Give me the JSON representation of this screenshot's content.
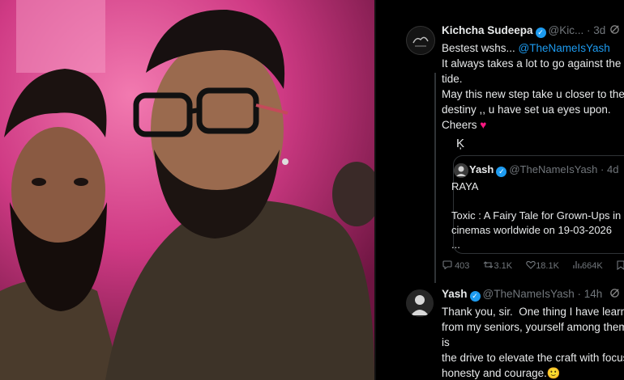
{
  "tweet1": {
    "name": "Kichcha Sudeepa",
    "handle": "@Kic...",
    "time": "· 3d",
    "body_prefix": "Bestest wshs... ",
    "mention": "@TheNameIsYash",
    "body_rest": "It always takes a lot to go against the\ntide.\nMay this new step take u closer to the\ndestiny ,, u have set ua eyes upon.\nCheers ",
    "heart": "♥",
    "signature": "Ķ"
  },
  "quote": {
    "name": "Yash",
    "handle": "@TheNameIsYash",
    "time": "· 4d",
    "body": "RAYA\n\nToxic : A Fairy Tale for Grown-Ups in\ncinemas worldwide on 19-03-2026\n..."
  },
  "actions": {
    "replies": "403",
    "reposts": "3.1K",
    "likes": "18.1K",
    "views": "664K"
  },
  "tweet2": {
    "name": "Yash",
    "handle": "@TheNameIsYash",
    "time": "· 14h",
    "body": "Thank you, sir.  One thing I have learnt\nfrom my seniors, yourself among them, is\nthe drive to elevate the craft with focus,\nhonesty and courage.",
    "emoji": "🙂"
  },
  "icons": {
    "verified": "check-icon",
    "grok": "grok-icon",
    "reply": "reply-icon",
    "repost": "repost-icon",
    "like": "heart-icon",
    "views": "views-icon",
    "bookmark": "bookmark-icon"
  },
  "colors": {
    "accent": "#1d9bf0",
    "muted": "#71767b",
    "text": "#e7e9ea",
    "background": "#000000",
    "photo_pink": "#d63c86"
  }
}
